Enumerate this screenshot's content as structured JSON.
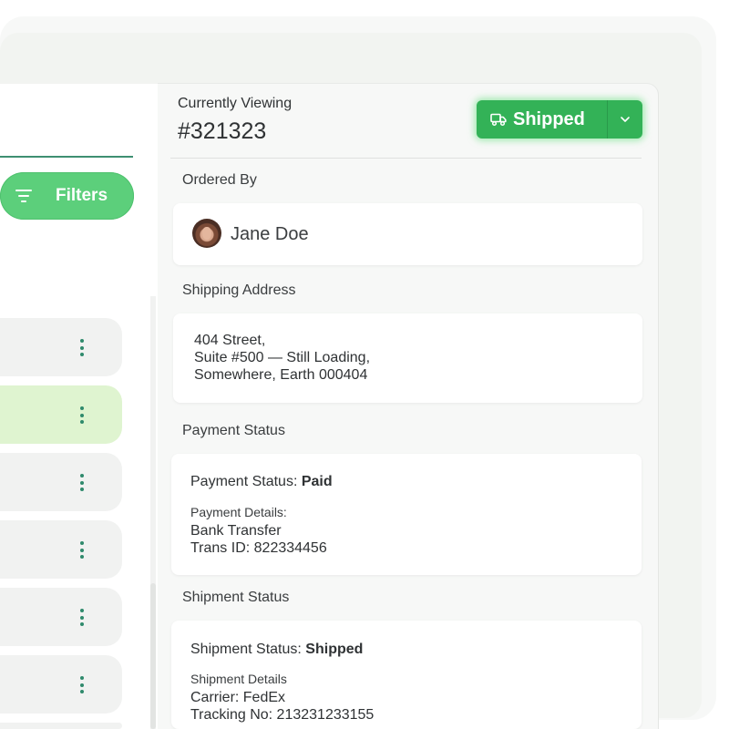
{
  "filters": {
    "label": "Filters"
  },
  "order_rows": [
    {
      "selected": false
    },
    {
      "selected": true
    },
    {
      "selected": false
    },
    {
      "selected": false
    },
    {
      "selected": false
    },
    {
      "selected": false
    }
  ],
  "detail": {
    "viewing_label": "Currently Viewing",
    "order_id": "#321323",
    "status_button": {
      "label": "Shipped"
    },
    "ordered_by": {
      "section": "Ordered By",
      "name": "Jane Doe"
    },
    "shipping_address": {
      "section": "Shipping Address",
      "lines": [
        "404 Street,",
        "Suite #500 — Still Loading,",
        "Somewhere, Earth 000404"
      ]
    },
    "payment": {
      "section": "Payment Status",
      "status_prefix": "Payment Status: ",
      "status_value": "Paid",
      "details_title": "Payment Details:",
      "method": "Bank Transfer",
      "trans_id": "Trans ID: 822334456"
    },
    "shipment": {
      "section": "Shipment Status",
      "status_prefix": "Shipment Status: ",
      "status_value": "Shipped",
      "details_title": "Shipment Details",
      "carrier": "Carrier: FedEx",
      "tracking": "Tracking No: 213231233155"
    }
  },
  "colors": {
    "accent_green": "#33b257",
    "filters_green": "#5ccf7b",
    "selected_row": "#dff4d0",
    "kebab_green": "#2f8a6c"
  },
  "icons": {
    "filters": "filter-lines-icon",
    "status": "truck-icon",
    "caret": "chevron-down-icon",
    "row_menu": "kebab-menu-icon"
  }
}
